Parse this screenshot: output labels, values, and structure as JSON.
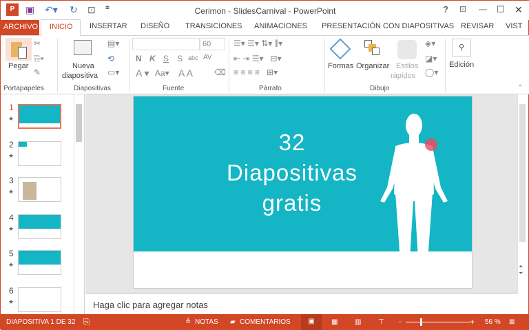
{
  "window": {
    "title": "Cerimon - SlidesCarnival - PowerPoint",
    "help": "?",
    "restore_ribbon": "⊡",
    "minimize": "—",
    "maximize": "☐",
    "close": "✕"
  },
  "tabs": [
    "ARCHIVO",
    "INICIO",
    "INSERTAR",
    "DISEÑO",
    "TRANSICIONES",
    "ANIMACIONES",
    "PRESENTACIÓN CON DIAPOSITIVAS",
    "REVISAR",
    "VIST"
  ],
  "ribbon": {
    "pegar": "Pegar",
    "nueva": "Nueva",
    "diapositiva": "diapositiva",
    "font_size": "60",
    "font_btns": [
      "N",
      "K",
      "S",
      "S",
      "abc",
      "AV"
    ],
    "formas": "Formas",
    "organizar": "Organizar",
    "estilos": "Estilos",
    "rapidos": "rápidos",
    "edicion": "Edición",
    "groups": [
      "Portapapeles",
      "Diapositivas",
      "Fuente",
      "Párrafo",
      "Dibujo"
    ]
  },
  "thumbnails": [
    {
      "n": "1"
    },
    {
      "n": "2"
    },
    {
      "n": "3"
    },
    {
      "n": "4"
    },
    {
      "n": "5"
    },
    {
      "n": "6"
    }
  ],
  "slide": {
    "line1": "32",
    "line2": "Diapositivas",
    "line3": "gratis"
  },
  "notes_placeholder": "Haga clic para agregar notas",
  "status": {
    "slide": "DIAPOSITIVA 1 DE 32",
    "notas": "NOTAS",
    "comentarios": "COMENTARIOS",
    "zoom": "56 %"
  },
  "colors": {
    "accent": "#d24726",
    "teal": "#14b5c4"
  }
}
